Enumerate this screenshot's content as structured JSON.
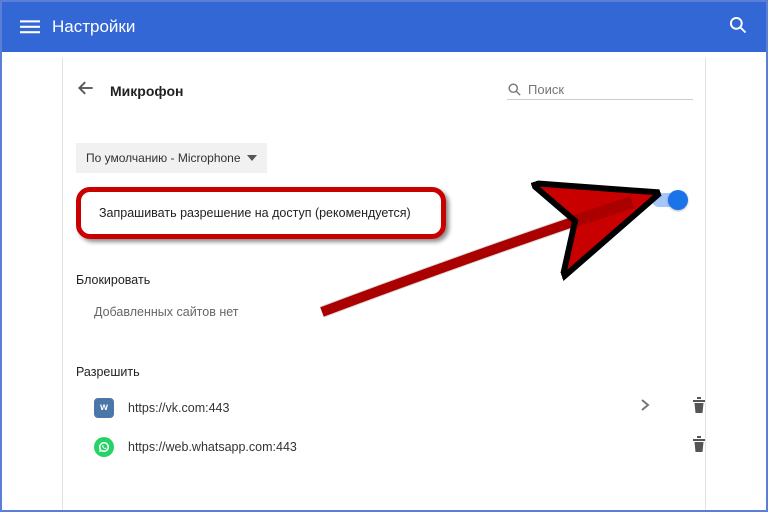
{
  "appbar": {
    "title": "Настройки"
  },
  "page": {
    "section_title": "Микрофон",
    "search_placeholder": "Поиск",
    "dropdown_label": "По умолчанию - Microphone",
    "permission_label": "Запрашивать разрешение на доступ (рекомендуется)",
    "block_heading": "Блокировать",
    "block_empty": "Добавленных сайтов нет",
    "allow_heading": "Разрешить",
    "allow_sites": [
      {
        "url": "https://vk.com:443",
        "icon": "vk"
      },
      {
        "url": "https://web.whatsapp.com:443",
        "icon": "whatsapp"
      }
    ]
  }
}
